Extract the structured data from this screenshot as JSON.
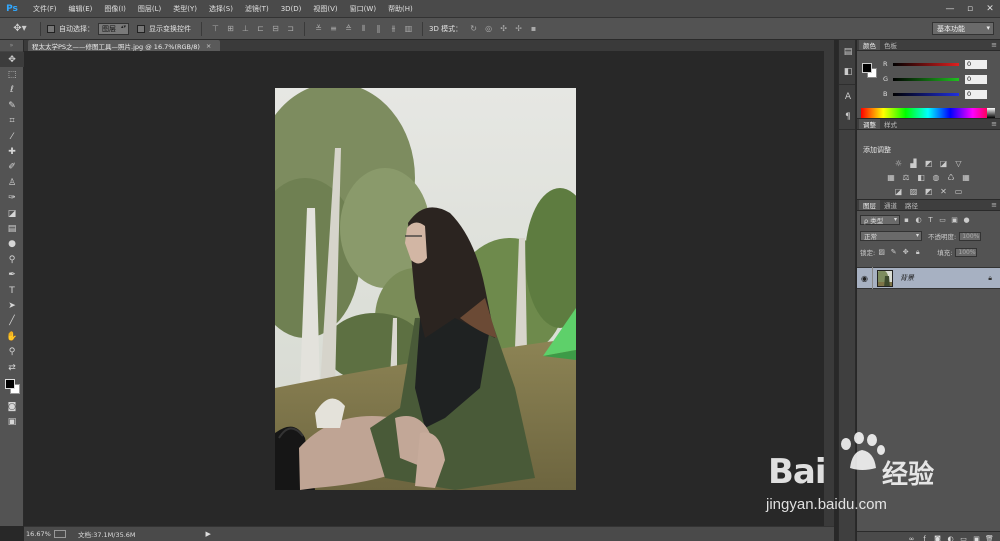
{
  "app": {
    "logo": "Ps"
  },
  "menu": [
    "文件(F)",
    "编辑(E)",
    "图像(I)",
    "图层(L)",
    "类型(Y)",
    "选择(S)",
    "滤镜(T)",
    "3D(D)",
    "视图(V)",
    "窗口(W)",
    "帮助(H)"
  ],
  "window_buttons": [
    "—",
    "▫",
    "✕"
  ],
  "options": {
    "auto_select_label": "自动选择：",
    "auto_select_value": "图层",
    "show_transform_label": "显示变换控件",
    "mode_3d_label": "3D 模式：",
    "workspace": "基本功能"
  },
  "document_tab": {
    "title": "程太太学PS之——修图工具—照片.jpg @ 16.7%(RGB/8)",
    "close": "×"
  },
  "status": {
    "zoom": "16.67%",
    "doc": "文档:37.1M/35.6M",
    "arrow": "▶"
  },
  "color_panel": {
    "tabs": [
      "颜色",
      "色板"
    ],
    "channels": [
      {
        "label": "R",
        "value": "0",
        "color": "#e02020"
      },
      {
        "label": "G",
        "value": "0",
        "color": "#20c020"
      },
      {
        "label": "B",
        "value": "0",
        "color": "#2030e0"
      }
    ]
  },
  "adjust_panel": {
    "tabs": [
      "调整",
      "样式"
    ],
    "title": "添加调整"
  },
  "layers_panel": {
    "tabs": [
      "图层",
      "通道",
      "路径"
    ],
    "filter_label": "ρ 类型",
    "blend_mode": "正常",
    "opacity_label": "不透明度:",
    "opacity_value": "100%",
    "lock_label": "锁定:",
    "fill_label": "填充:",
    "fill_value": "100%",
    "layer_name": "背景"
  },
  "watermark": {
    "brand": "Bai",
    "brand_cn": "经验",
    "url": "jingyan.baidu.com"
  }
}
